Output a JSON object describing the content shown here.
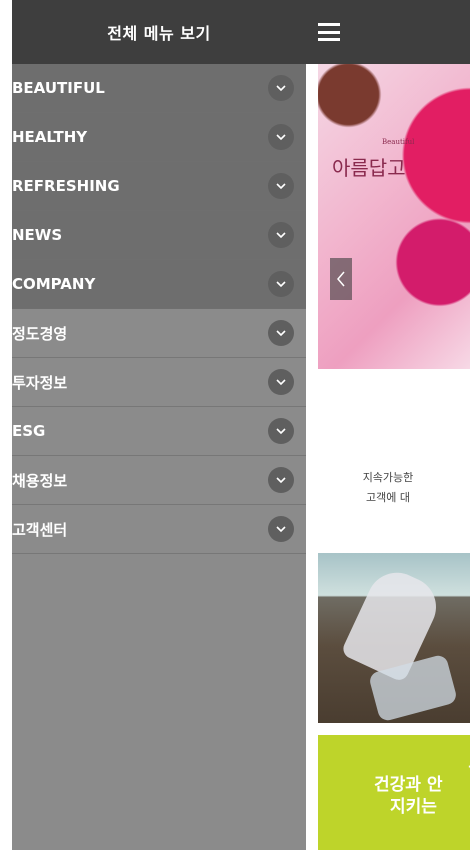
{
  "drawer": {
    "title": "전체 메뉴 보기",
    "items": [
      {
        "label": "BEAUTIFUL",
        "style": "dark"
      },
      {
        "label": "HEALTHY",
        "style": "dark"
      },
      {
        "label": "REFRESHING",
        "style": "dark"
      },
      {
        "label": "NEWS",
        "style": "dark"
      },
      {
        "label": "COMPANY",
        "style": "dark"
      },
      {
        "label": "정도경영",
        "style": "light"
      },
      {
        "label": "투자정보",
        "style": "light"
      },
      {
        "label": "ESG",
        "style": "light"
      },
      {
        "label": "채용정보",
        "style": "light"
      },
      {
        "label": "고객센터",
        "style": "light"
      }
    ],
    "chevron_icon": "chevron-down-icon"
  },
  "main": {
    "hero": {
      "small_text": "Beautiful",
      "title": "아름답고"
    },
    "body_lines": [
      "지속가능한",
      "고객에 대"
    ],
    "green_lines": [
      "고",
      "건강과 안",
      "지키는"
    ]
  },
  "colors": {
    "header_bg": "#3e3e3e",
    "menu_dark": "#6e6e6e",
    "menu_light": "#8b8b8b",
    "green": "#bed42a"
  }
}
